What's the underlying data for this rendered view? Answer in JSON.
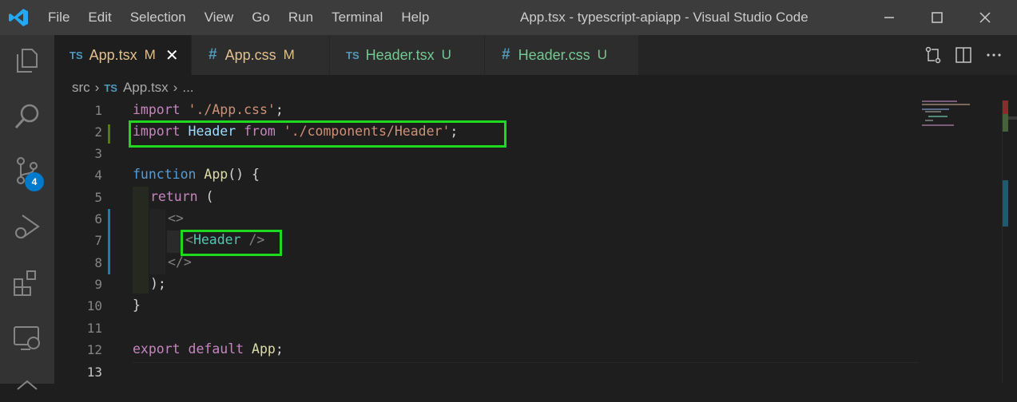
{
  "menu": [
    "File",
    "Edit",
    "Selection",
    "View",
    "Go",
    "Run",
    "Terminal",
    "Help"
  ],
  "window_title": "App.tsx - typescript-apiapp - Visual Studio Code",
  "activity_badge": "4",
  "tabs": [
    {
      "prefix": "TS",
      "name": "App.tsx",
      "status": "M",
      "active": true,
      "close": "✕"
    },
    {
      "prefix": "#",
      "name": "App.css",
      "status": "M",
      "active": false
    },
    {
      "prefix": "TS",
      "name": "Header.tsx",
      "status": "U",
      "active": false
    },
    {
      "prefix": "#",
      "name": "Header.css",
      "status": "U",
      "active": false
    }
  ],
  "breadcrumb": {
    "folder": "src",
    "file_prefix": "TS",
    "file": "App.tsx",
    "more": "..."
  },
  "line_numbers": [
    "1",
    "2",
    "3",
    "4",
    "5",
    "6",
    "7",
    "8",
    "9",
    "10",
    "11",
    "12",
    "13"
  ],
  "code": {
    "l1": {
      "kw": "import",
      "str": "'./App.css'",
      "end": ";"
    },
    "l2": {
      "kw": "import",
      "var": "Header",
      "from": "from",
      "str": "'./components/Header'",
      "end": ";"
    },
    "l4": {
      "kw": "function",
      "fn": "App",
      "rest": "() {"
    },
    "l5": {
      "kw": "return",
      "rest": "("
    },
    "l6": {
      "tag": "<>"
    },
    "l7": {
      "lt": "<",
      "tag": "Header",
      "close": "/>"
    },
    "l8": {
      "tag": "</>"
    },
    "l9": {
      "rest": ");"
    },
    "l10": {
      "rest": "}"
    },
    "l12": {
      "kw": "export",
      "kw2": "default",
      "var": "App",
      "end": ";"
    }
  },
  "colors": {
    "highlight": "#1ed91e",
    "accent": "#007acc",
    "modified": "#e2c08d",
    "untracked": "#73c991"
  }
}
